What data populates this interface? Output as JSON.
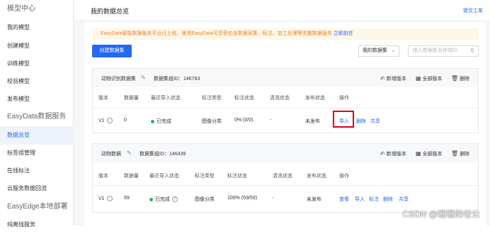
{
  "sidebar": {
    "items": [
      {
        "label": "模型中心",
        "section": true
      },
      {
        "label": "我的模型"
      },
      {
        "label": "创建模型"
      },
      {
        "label": "训练模型"
      },
      {
        "label": "校验模型"
      },
      {
        "label": "发布模型"
      },
      {
        "label": "EasyData数据服务",
        "section": true
      },
      {
        "label": "数据总览",
        "active": true
      },
      {
        "label": "标签组管理"
      },
      {
        "label": "在线标注"
      },
      {
        "label": "云服务数据回流"
      },
      {
        "label": "EasyEdge本地部署",
        "section": true
      },
      {
        "label": "纯离线服务"
      }
    ]
  },
  "header": {
    "title": "我的数据总览",
    "feedback": "提交工单"
  },
  "notice": {
    "text": "EasyData智能数据服务平台已上线，使用EasyData可享受包含数据采集、标注、加工处理等完整数据服务",
    "link": "立即前往"
  },
  "toolbar": {
    "create_label": "创建数据集",
    "filter_value": "我的数据集",
    "search_placeholder": "输入数据集名称或ID"
  },
  "datasets": [
    {
      "name": "动物识别数据集",
      "group_id_label": "数据集组ID：146763",
      "actions": [
        "新增版本",
        "全部版本",
        "删除"
      ],
      "columns": [
        "版本",
        "数据量",
        "最近导入状态",
        "标注类型",
        "标注状态",
        "清洗状态",
        "发布状态",
        "操作"
      ],
      "row": {
        "version": "V1",
        "count": "0",
        "import_status": "已完成",
        "label_type": "图像分类",
        "label_status": "0% (0/0)",
        "clean_status": "-",
        "publish_status": "未发布",
        "ops": [
          "导入",
          "删除",
          "共享"
        ]
      }
    },
    {
      "name": "动物数据",
      "group_id_label": "数据集组ID：146439",
      "actions": [
        "新增版本",
        "全部版本",
        "删除"
      ],
      "columns": [
        "版本",
        "数据量",
        "最近导入状态",
        "标注类型",
        "标注状态",
        "清洗状态",
        "发布状态",
        "操作"
      ],
      "row": {
        "version": "V1",
        "count": "59",
        "import_status": "已完成",
        "label_type": "图像分类",
        "label_status": "100% (59/59)",
        "clean_status": "-",
        "publish_status": "未发布",
        "ops": [
          "查看",
          "导入",
          "标注",
          "删除",
          "共享"
        ]
      }
    }
  ],
  "watermark": "CSDN @珊珊的老公",
  "colors": {
    "accent": "#2468f2",
    "highlight": "#d9001b",
    "success": "#2db55d",
    "notice_text": "#e8862c"
  }
}
